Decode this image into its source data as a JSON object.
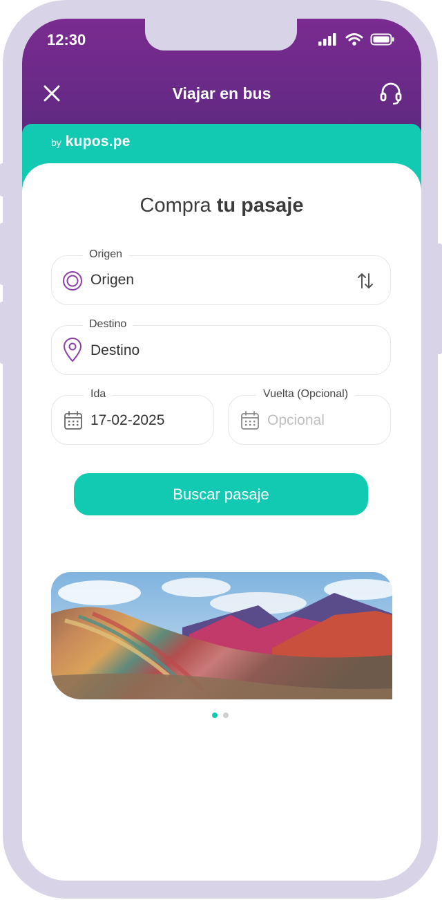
{
  "status_bar": {
    "time": "12:30"
  },
  "header": {
    "title": "Viajar en bus"
  },
  "brand": {
    "by": "by",
    "name": "kupos.pe"
  },
  "form": {
    "heading_regular": "Compra ",
    "heading_bold": "tu pasaje",
    "origin": {
      "label": "Origen",
      "value": "Origen"
    },
    "destination": {
      "label": "Destino",
      "value": "Destino"
    },
    "departure": {
      "label": "Ida",
      "value": "17-02-2025"
    },
    "return": {
      "label": "Vuelta (Opcional)",
      "placeholder": "Opcional"
    },
    "search_label": "Buscar pasaje"
  },
  "carousel": {
    "slide_count": 2,
    "active_index": 0
  },
  "colors": {
    "purple": "#6a2a88",
    "teal": "#12c9b2",
    "frame": "#d8d3e6"
  },
  "icons": [
    "close-icon",
    "headset-icon",
    "swap-icon",
    "origin-icon",
    "location-pin-icon",
    "calendar-icon",
    "signal-icon",
    "wifi-icon",
    "battery-icon"
  ]
}
